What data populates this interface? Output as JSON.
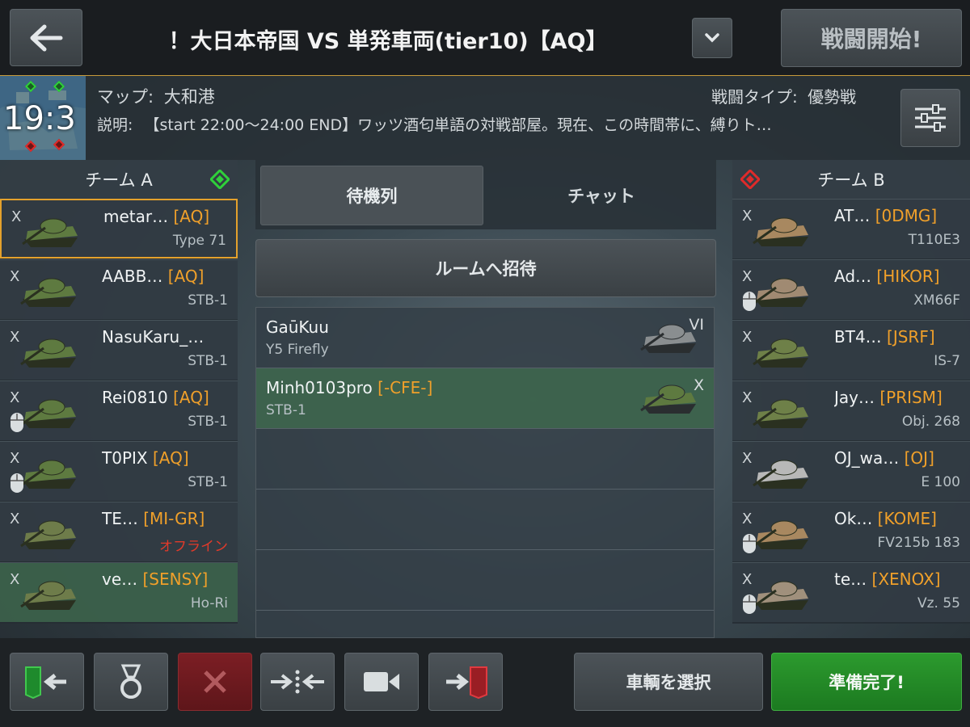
{
  "header": {
    "title": "！大日本帝国 VS 単発車両(tier10)【AQ】",
    "start_button": "戦闘開始!",
    "back_icon": "arrow-left-icon",
    "dropdown_icon": "chevron-down-icon"
  },
  "info": {
    "timer": "19:3",
    "map_label": "マップ:",
    "map_value": "大和港",
    "battle_type_label": "戦闘タイプ:",
    "battle_type_value": "優勢戦",
    "description_label": "説明:",
    "description_value": "【start 22:00～24:00 END】ワッツ酒匂単語の対戦部屋。現在、この時間帯に、縛りト…"
  },
  "team_a": {
    "title": "チーム A",
    "color": "#2fd13a",
    "players": [
      {
        "name": "metar…",
        "clan": "[AQ]",
        "tank": "Type 71",
        "remove": "X"
      },
      {
        "name": "AABB…",
        "clan": "[AQ]",
        "tank": "STB-1",
        "remove": "X"
      },
      {
        "name": "NasuKaru_…",
        "clan": "",
        "tank": "STB-1",
        "remove": "X"
      },
      {
        "name": "Rei0810",
        "clan": "[AQ]",
        "tank": "STB-1",
        "remove": "X"
      },
      {
        "name": "T0PIX",
        "clan": "[AQ]",
        "tank": "STB-1",
        "remove": "X"
      },
      {
        "name": "TE…",
        "clan": "[MI-GR]",
        "tank": "オフライン",
        "remove": "X"
      },
      {
        "name": "ve…",
        "clan": "[SENSY]",
        "tank": "Ho-Ri",
        "remove": "X"
      }
    ]
  },
  "team_b": {
    "title": "チーム B",
    "color": "#e02a2a",
    "players": [
      {
        "name": "AT…",
        "clan": "[0DMG]",
        "tank": "T110E3",
        "remove": "X"
      },
      {
        "name": "Ad…",
        "clan": "[HIKOR]",
        "tank": "XM66F",
        "remove": "X"
      },
      {
        "name": "BT4…",
        "clan": "[JSRF]",
        "tank": "IS-7",
        "remove": "X"
      },
      {
        "name": "Jay…",
        "clan": "[PRISM]",
        "tank": "Obj. 268",
        "remove": "X"
      },
      {
        "name": "OJ_wa…",
        "clan": "[OJ]",
        "tank": "E 100",
        "remove": "X"
      },
      {
        "name": "Ok…",
        "clan": "[KOME]",
        "tank": "FV215b 183",
        "remove": "X"
      },
      {
        "name": "te…",
        "clan": "[XENOX]",
        "tank": "Vz. 55",
        "remove": "X"
      }
    ]
  },
  "middle": {
    "tab_queue": "待機列",
    "tab_chat": "チャット",
    "invite_button": "ルームへ招待",
    "queue": [
      {
        "name": "GaūKuu",
        "clan": "",
        "tank": "Y5 Firefly",
        "tier": "VI"
      },
      {
        "name": "Minh0103pro",
        "clan": "[-CFE-]",
        "tank": "STB-1",
        "tier": "X"
      }
    ]
  },
  "bottom": {
    "select_vehicle": "車輌を選択",
    "ready": "準備完了!",
    "icons": [
      "exit-to-team-a-icon",
      "medal-icon",
      "close-icon",
      "swap-teams-icon",
      "camera-icon",
      "exit-to-team-b-icon"
    ]
  }
}
